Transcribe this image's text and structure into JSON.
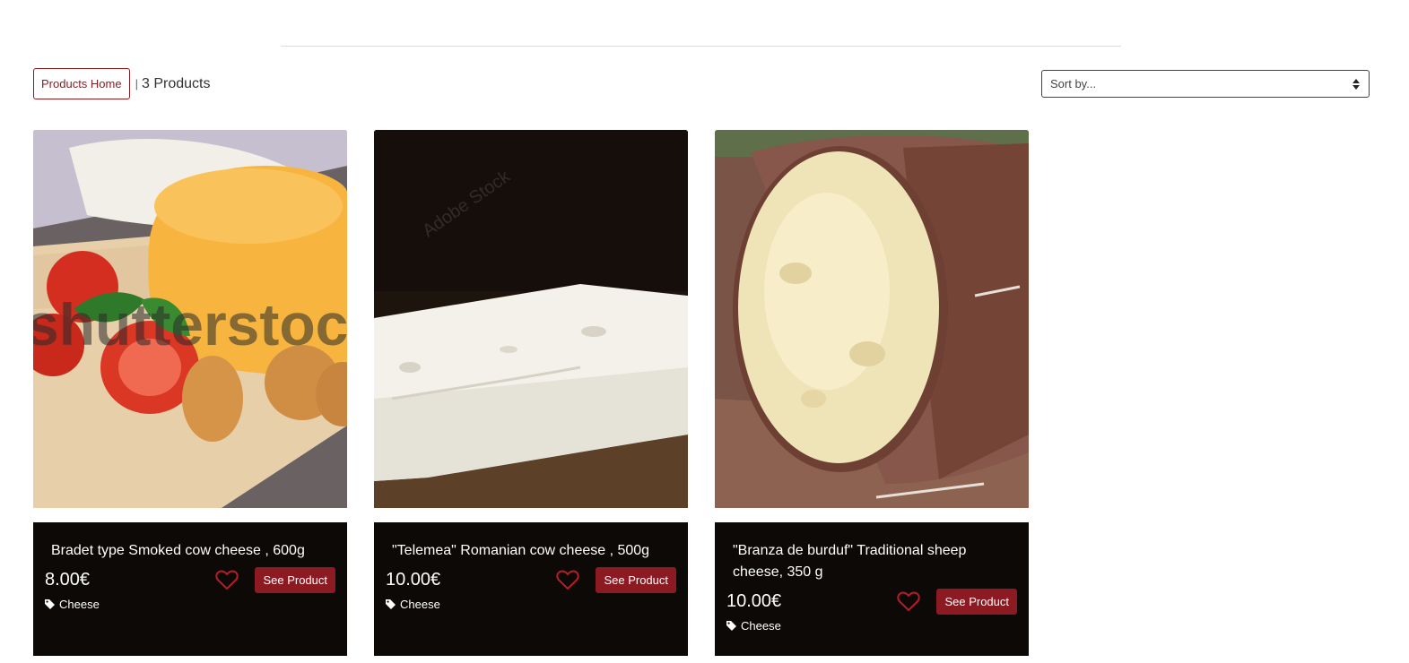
{
  "toolbar": {
    "home_label": "Products Home",
    "separator": "|",
    "count_text": "3 Products"
  },
  "sort": {
    "placeholder": "Sort by..."
  },
  "colors": {
    "accent": "#8c1a22",
    "card_background": "#0c0906"
  },
  "products": [
    {
      "title": "Bradet type Smoked cow cheese , 600g",
      "price": "8.00€",
      "button_label": "See Product",
      "category": "Cheese",
      "watermark": "shutterstock"
    },
    {
      "title": "\"Telemea\" Romanian cow cheese , 500g",
      "price": "10.00€",
      "button_label": "See Product",
      "category": "Cheese",
      "watermark": "Adobe Stock"
    },
    {
      "title": "\"Branza de burduf\" Traditional sheep cheese, 350 g",
      "price": "10.00€",
      "button_label": "See Product",
      "category": "Cheese"
    }
  ],
  "icons": {
    "sort": "sort-arrows-icon",
    "favorite": "heart-outline-icon",
    "category": "tag-icon"
  }
}
